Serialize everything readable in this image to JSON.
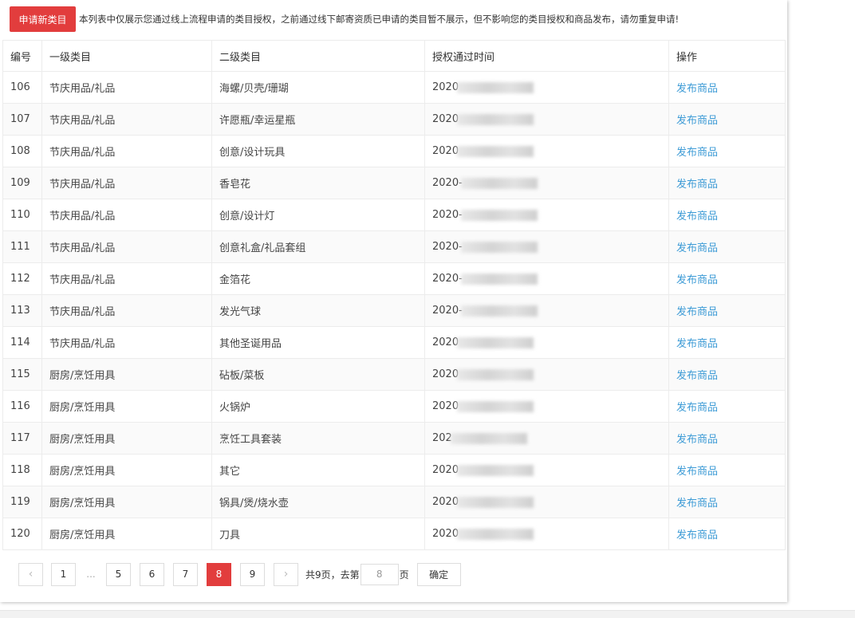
{
  "header": {
    "apply_button": "申请新类目",
    "notice": "本列表中仅展示您通过线上流程申请的类目授权，之前通过线下邮寄资质已申请的类目暂不展示，但不影响您的类目授权和商品发布，请勿重复申请!"
  },
  "table": {
    "columns": [
      "编号",
      "一级类目",
      "二级类目",
      "授权通过时间",
      "操作"
    ],
    "action_label": "发布商品",
    "rows": [
      {
        "id": "106",
        "cat1": "节庆用品/礼品",
        "cat2": "海螺/贝壳/珊瑚",
        "time": "2020"
      },
      {
        "id": "107",
        "cat1": "节庆用品/礼品",
        "cat2": "许愿瓶/幸运星瓶",
        "time": "2020"
      },
      {
        "id": "108",
        "cat1": "节庆用品/礼品",
        "cat2": "创意/设计玩具",
        "time": "2020"
      },
      {
        "id": "109",
        "cat1": "节庆用品/礼品",
        "cat2": "香皂花",
        "time": "2020-"
      },
      {
        "id": "110",
        "cat1": "节庆用品/礼品",
        "cat2": "创意/设计灯",
        "time": "2020-"
      },
      {
        "id": "111",
        "cat1": "节庆用品/礼品",
        "cat2": "创意礼盒/礼品套组",
        "time": "2020-"
      },
      {
        "id": "112",
        "cat1": "节庆用品/礼品",
        "cat2": "金箔花",
        "time": "2020-"
      },
      {
        "id": "113",
        "cat1": "节庆用品/礼品",
        "cat2": "发光气球",
        "time": "2020-"
      },
      {
        "id": "114",
        "cat1": "节庆用品/礼品",
        "cat2": "其他圣诞用品",
        "time": "2020"
      },
      {
        "id": "115",
        "cat1": "厨房/烹饪用具",
        "cat2": "砧板/菜板",
        "time": "2020"
      },
      {
        "id": "116",
        "cat1": "厨房/烹饪用具",
        "cat2": "火锅炉",
        "time": "2020"
      },
      {
        "id": "117",
        "cat1": "厨房/烹饪用具",
        "cat2": "烹饪工具套装",
        "time": "202"
      },
      {
        "id": "118",
        "cat1": "厨房/烹饪用具",
        "cat2": "其它",
        "time": "2020"
      },
      {
        "id": "119",
        "cat1": "厨房/烹饪用具",
        "cat2": "锅具/煲/烧水壶",
        "time": "2020"
      },
      {
        "id": "120",
        "cat1": "厨房/烹饪用具",
        "cat2": "刀具",
        "time": "2020"
      }
    ]
  },
  "pagination": {
    "prev_icon": "chevron-left-icon",
    "next_icon": "chevron-right-icon",
    "pages": [
      "1",
      "5",
      "6",
      "7",
      "8",
      "9"
    ],
    "current": "8",
    "ellipsis": "...",
    "total_text": "共9页，去第",
    "input_value": "8",
    "page_suffix": "页",
    "confirm_label": "确定"
  },
  "colors": {
    "accent_red": "#e23d3d",
    "link_blue": "#3d9bd6"
  }
}
